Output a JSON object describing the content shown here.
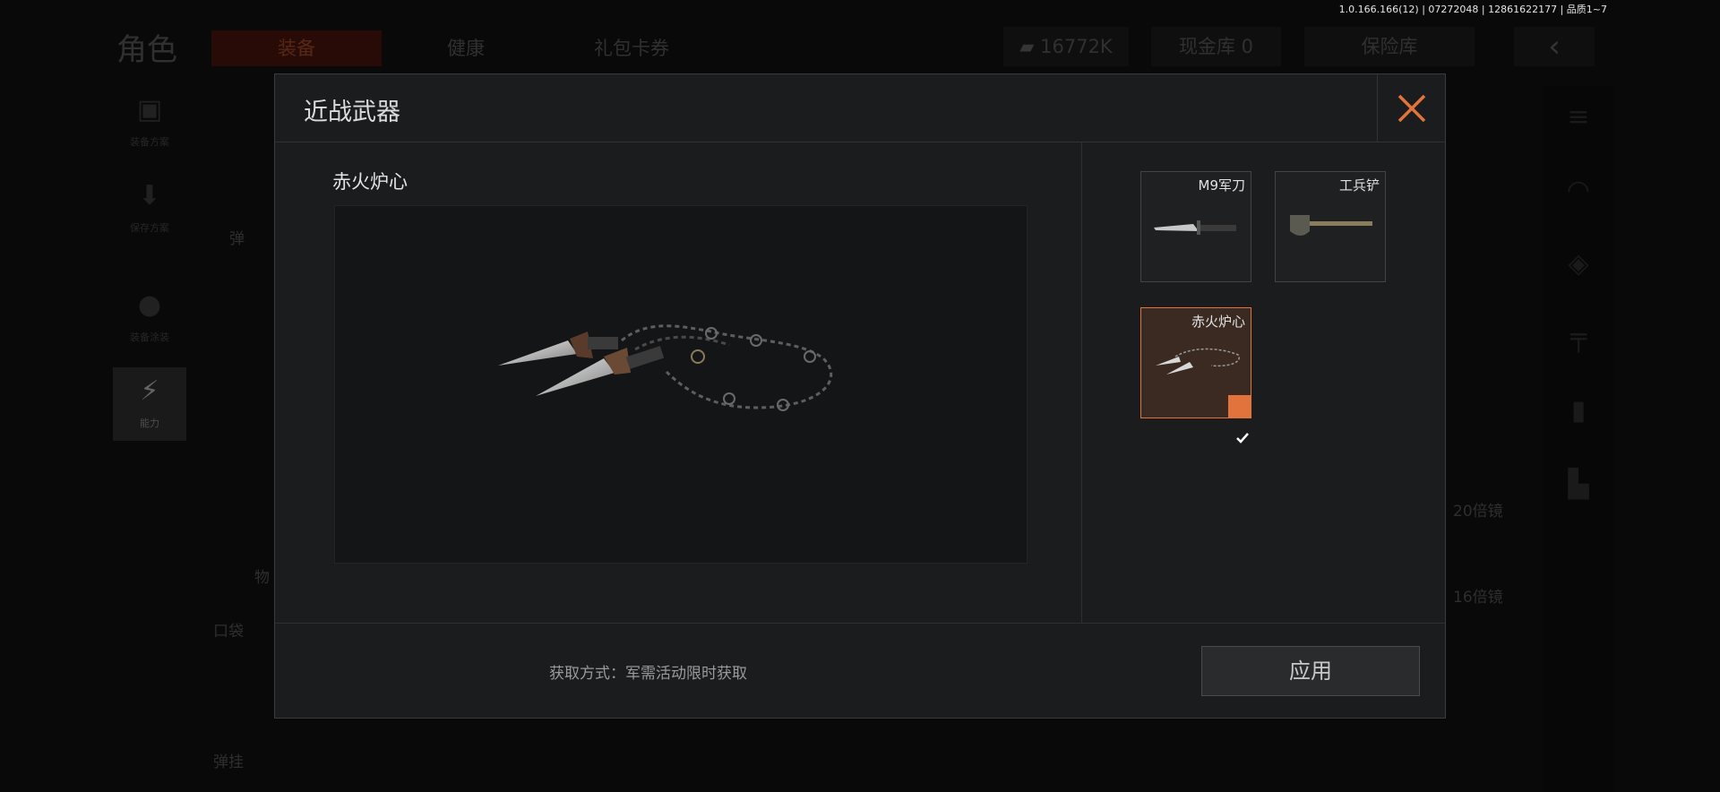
{
  "version_info": "1.0.166.166(12) | 07272048 | 12861622177 | 品质1~7",
  "background": {
    "title": "角色",
    "tabs": [
      {
        "label": "装备",
        "active": true
      },
      {
        "label": "健康",
        "active": false
      },
      {
        "label": "礼包卡券",
        "active": false
      }
    ],
    "currency": "16772K",
    "cash_vault": "现金库 0",
    "insurance": "保险库",
    "sidebar": [
      {
        "label": "装备方案",
        "icon": "vest-icon"
      },
      {
        "label": "保存方案",
        "icon": "download-icon"
      },
      {
        "label": "装备涂装",
        "icon": "helmet-icon"
      },
      {
        "label": "能力",
        "icon": "lightning-icon"
      }
    ],
    "labels": {
      "ammo": "弹",
      "items": "物",
      "pocket": "口袋",
      "sling": "弹挂",
      "scope20": "20倍镜",
      "scope16": "16倍镜"
    }
  },
  "modal": {
    "title": "近战武器",
    "selected_item": "赤火炉心",
    "items": [
      {
        "name": "M9军刀",
        "selected": false
      },
      {
        "name": "工兵铲",
        "selected": false
      },
      {
        "name": "赤火炉心",
        "selected": true
      }
    ],
    "acquire_text": "获取方式：军需活动限时获取",
    "apply_label": "应用"
  },
  "colors": {
    "accent": "#e2733d",
    "bg": "#1b1c1d"
  }
}
